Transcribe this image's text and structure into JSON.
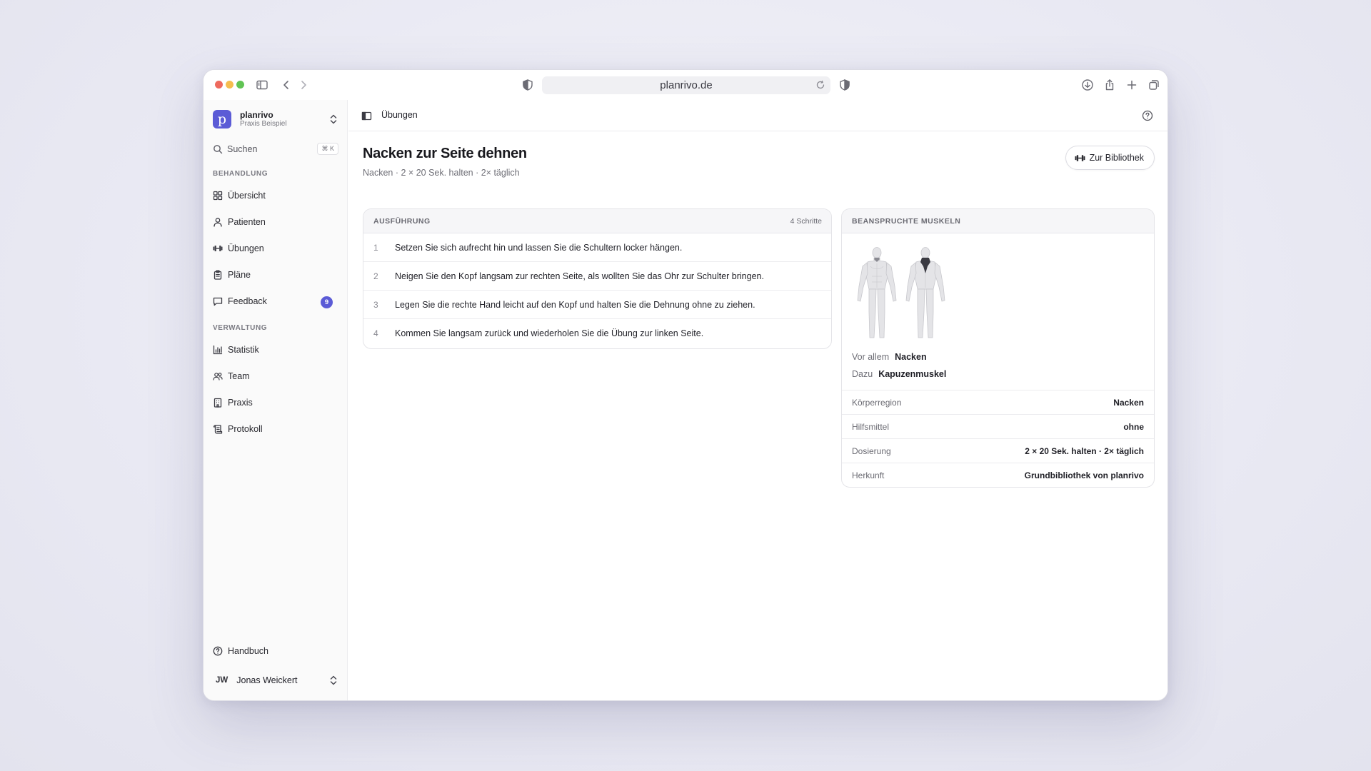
{
  "browser": {
    "url": "planrivo.de"
  },
  "sidebar": {
    "brand": {
      "name": "planrivo",
      "workspace": "Praxis Beispiel",
      "logo_letter": "p"
    },
    "search": {
      "label": "Suchen",
      "shortcut": "⌘ K"
    },
    "sections": [
      {
        "label": "BEHANDLUNG",
        "items": [
          {
            "label": "Übersicht",
            "icon": "grid-icon"
          },
          {
            "label": "Patienten",
            "icon": "user-icon"
          },
          {
            "label": "Übungen",
            "icon": "dumbbell-icon"
          },
          {
            "label": "Pläne",
            "icon": "clipboard-icon"
          },
          {
            "label": "Feedback",
            "icon": "message-icon",
            "badge": "9"
          }
        ]
      },
      {
        "label": "VERWALTUNG",
        "items": [
          {
            "label": "Statistik",
            "icon": "bar-chart-icon"
          },
          {
            "label": "Team",
            "icon": "users-icon"
          },
          {
            "label": "Praxis",
            "icon": "building-icon"
          },
          {
            "label": "Protokoll",
            "icon": "scroll-icon"
          }
        ]
      }
    ],
    "help": {
      "label": "Handbuch"
    },
    "user": {
      "initials": "JW",
      "name": "Jonas Weickert"
    }
  },
  "header": {
    "breadcrumb": "Übungen"
  },
  "exercise": {
    "title": "Nacken zur Seite dehnen",
    "subtitle": "Nacken · 2 × 20 Sek. halten · 2× täglich",
    "library_button": "Zur Bibliothek"
  },
  "steps_card": {
    "title": "AUSFÜHRUNG",
    "count": "4 Schritte",
    "steps": [
      {
        "n": "1",
        "text": "Setzen Sie sich aufrecht hin und lassen Sie die Schultern locker hängen."
      },
      {
        "n": "2",
        "text": "Neigen Sie den Kopf langsam zur rechten Seite, als wollten Sie das Ohr zur Schulter bringen."
      },
      {
        "n": "3",
        "text": "Legen Sie die rechte Hand leicht auf den Kopf und halten Sie die Dehnung ohne zu ziehen."
      },
      {
        "n": "4",
        "text": "Kommen Sie langsam zurück und wiederholen Sie die Übung zur linken Seite."
      }
    ]
  },
  "muscles_card": {
    "title": "BEANSPRUCHTE MUSKELN",
    "primary_label": "Vor allem",
    "primary_value": "Nacken",
    "secondary_label": "Dazu",
    "secondary_value": "Kapuzenmuskel",
    "details": [
      {
        "label": "Körperregion",
        "value": "Nacken"
      },
      {
        "label": "Hilfsmittel",
        "value": "ohne"
      },
      {
        "label": "Dosierung",
        "value": "2 × 20 Sek. halten · 2× täglich"
      },
      {
        "label": "Herkunft",
        "value": "Grundbibliothek von planrivo"
      }
    ],
    "colors": {
      "body": "#e4e4e7",
      "body_stroke": "#c8c8cd",
      "highlight": "#3a3a42"
    }
  },
  "colors": {
    "accent": "#5b5bd6"
  }
}
